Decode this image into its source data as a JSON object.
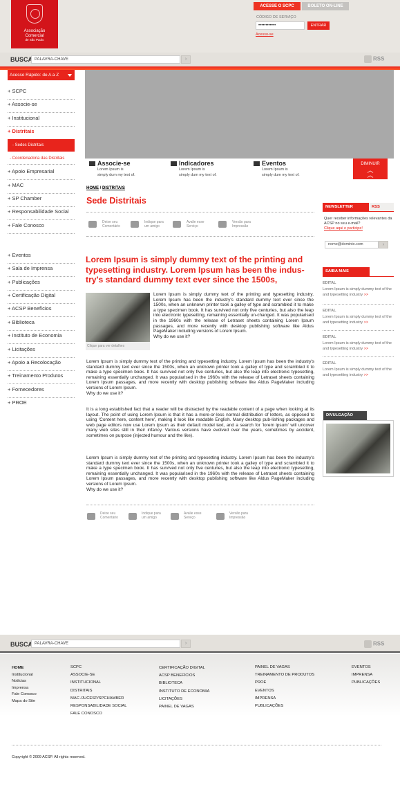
{
  "header": {
    "logo_text": [
      "Associação",
      "Comercial",
      "de São Paulo"
    ],
    "tab_scpc": "ACESSE O SCPC",
    "tab_boleto": "BOLETO ON-LINE",
    "codigo_label": "CÓDIGO DE SERVIÇO",
    "codigo_value": "••••••••••••",
    "entrar_button": "ENTRAR",
    "acesso_link": "Acesso-se"
  },
  "search": {
    "label": "BUSCA",
    "placeholder": "PALAVRA-CHAVE",
    "go": "›",
    "rss": "RSS"
  },
  "sidebar": {
    "quick_access": "Acesso Rápido: de A a Z",
    "items_top": [
      "+ SCPC",
      "+ Associe-se",
      "+ Institucional",
      "+ Distritais"
    ],
    "sub_active": "- Sedes Distritais",
    "sub_item": "- Coordenadoria das Distritais",
    "items_mid": [
      "+ Apoio Empresarial",
      "+ MAC",
      "+ SP Chamber",
      "+ Responsabilidade Social",
      "+ Fale Conosco"
    ],
    "items_bottom": [
      "+ Eventos",
      "+ Sala de Imprensa",
      "+ Publicações",
      "+ Certificação Digital",
      "+ ACSP Benefícios",
      "+ Biblioteca",
      "+ Instituto de Economia",
      "+ Licitações",
      "+ Apoio a Recolocação",
      "+ Treinamento Produtos",
      "+ Fornecedores",
      "+ PROE"
    ]
  },
  "banner": {
    "items": [
      {
        "title": "Associe-se",
        "line1": "Lorem Ipsum is",
        "line2": "simply dum my text of."
      },
      {
        "title": "Indicadores",
        "line1": "Lorem Ipsum is",
        "line2": "simply dum my text of."
      },
      {
        "title": "Eventos",
        "line1": "Lorem Ipsum is",
        "line2": "simply dum my text of."
      }
    ],
    "diminuir": "DIMINUIR"
  },
  "content": {
    "breadcrumb_home": "HOME",
    "breadcrumb_sep": " / ",
    "breadcrumb_current": "DISTRITAIS",
    "title": "Sede Distritais",
    "actions": [
      {
        "line1": "Deixe seu",
        "line2": "Comentário"
      },
      {
        "line1": "Indique para",
        "line2": "um amigo"
      },
      {
        "line1": "Avalie esse",
        "line2": "Serviço"
      },
      {
        "line1": "Versão para",
        "line2": "Impressão"
      }
    ],
    "headline": "Lorem Ipsum is simply dummy text of the printing and typesetting industry. Lorem Ipsum has been the indus-try's standard dummy text ever since the 1500s,",
    "photo_caption": "Clique para ver detalhes",
    "para1": "Lorem Ipsum is simply dummy text of the printing and typesetting industry. Lorem Ipsum has been the industry's standard dummy text ever since the 1500s, when an unknown printer took a galley of type and scrambled it to make a type specimen book. It has survived not only five centuries, but also the leap into electronic typesetting, remaining essentially un-changed. It was popularised in the 1960s with the release of Letraset sheets containing Lorem Ipsum passages, and more recently with desktop publishing software like Aldus PageMaker including versions of Lorem Ipsum.",
    "para1_q": "Why do we use it?",
    "para2": "Lorem Ipsum is simply dummy text of the printing and typesetting industry. Lorem Ipsum has been the industry's standard dummy text ever since the 1500s, when an unknown printer took a galley of type and scrambled it to make a type specimen book. It has survived not only five centuries, but also the leap into electronic typesetting, remaining essentially unchanged. It was popularised in the 1960s with the release of Letraset sheets containing Lorem Ipsum passages, and more recently with desktop publishing software like Aldus PageMaker including versions of Lorem Ipsum.",
    "para2_q": "Why do we use it?",
    "para3": "It is a long established fact that a reader will be distracted by the readable content of a page when looking at its layout. The point of using Lorem Ipsum is that it has a more-or-less normal distribution of letters, as opposed to using 'Content here, content here', making it look like readable English. Many desktop pub-lishing packages and web page editors now use Lorem Ipsum as their default model text, and a search for 'lorem ipsum' will uncover many web sites still in their infancy. Various versions have evolved over the years, sometimes by accident, sometimes on purpose (injected humour and the like).",
    "para4": "Lorem Ipsum is simply dummy text of the printing and typesetting industry. Lorem Ipsum has been the industry's standard dummy text ever since the 1500s, when an unknown printer took a galley of type and scrambled it to make a type specimen book. It has survived not only five centuries, but also the leap into electronic typesetting, remaining essentially unchanged. It was popularised in the 1960s with the release of Letraset sheets containing Lorem Ipsum passages, and more recently with desktop publishing software like Aldus PageMaker including versions of Lorem Ipsum.",
    "para4_q": "Why do we use it?"
  },
  "right": {
    "newsletter_tab": "NEWSLETTER",
    "rss_tab": "RSS",
    "newsletter_text": "Quer receber informações relevantes da ACSP no seu e-mail?",
    "newsletter_link": "Clique aqui e participe!",
    "email_value": "nome@dominio.com",
    "saiba_mais": "SAIBA MAIS",
    "edital_title": "EDITAL",
    "edital_text": "Lorem Ipsum is simply dummy text of the and typesetting industry",
    "edital_more": ">>",
    "divulgacao": "DIVULGAÇÃO"
  },
  "footer": {
    "col1": [
      "HOME",
      "Institucional",
      "Notícias",
      "Imprensa",
      "Fale Conosco",
      "Mapa do Site"
    ],
    "col2": [
      "SCPC",
      "ASSOCIE-SE",
      "INSTITUCIONAL",
      "DISTRITAIS",
      "MAC /JUCESP/SPCHAMBER",
      "RESPONSABILIDADE SOCIAL",
      "FALE CONOSCO"
    ],
    "col3": [
      "CERTIFICAÇÃO DIGITAL",
      "ACSP BENEFÍCIOS",
      "BIBLIOTECA",
      "INSTITUTO DE ECONOMIA",
      "LICITAÇÕES",
      "PAINEL DE VAGAS"
    ],
    "col4": [
      "PAINEL DE VAGAS",
      "TREINAMENTO DE PRODUTOS",
      "PROE",
      "EVENTOS",
      "IMPRENSA",
      "PUBLICAÇÕES"
    ],
    "col5": [
      "EVENTOS",
      "IMPRENSA",
      "PUBLICAÇÕES"
    ],
    "copyright": "Copyright © 2009 ACSP. All rights reserved."
  },
  "colors": {
    "accent": "#e8241c",
    "header_bg": "#e9e6e1",
    "banner_gray": "#a9a9a9"
  }
}
